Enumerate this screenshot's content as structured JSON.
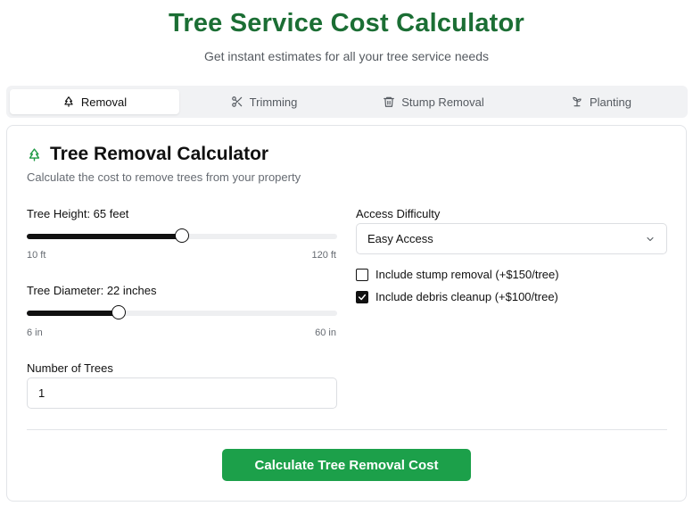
{
  "header": {
    "title": "Tree Service Cost Calculator",
    "subtitle": "Get instant estimates for all your tree service needs"
  },
  "tabs": [
    {
      "label": "Removal",
      "icon": "tree-icon",
      "active": true
    },
    {
      "label": "Trimming",
      "icon": "scissors-icon",
      "active": false
    },
    {
      "label": "Stump Removal",
      "icon": "trash-icon",
      "active": false
    },
    {
      "label": "Planting",
      "icon": "sprout-icon",
      "active": false
    }
  ],
  "card": {
    "title": "Tree Removal Calculator",
    "title_icon": "tree-icon",
    "description": "Calculate the cost to remove trees from your property"
  },
  "height_slider": {
    "label": "Tree Height: 65 feet",
    "value": 65,
    "min": 10,
    "max": 120,
    "min_label": "10 ft",
    "max_label": "120 ft"
  },
  "diameter_slider": {
    "label": "Tree Diameter: 22 inches",
    "value": 22,
    "min": 6,
    "max": 60,
    "min_label": "6 in",
    "max_label": "60 in"
  },
  "trees": {
    "label": "Number of Trees",
    "value": "1"
  },
  "access": {
    "label": "Access Difficulty",
    "selected": "Easy Access"
  },
  "options": [
    {
      "label": "Include stump removal (+$150/tree)",
      "checked": false
    },
    {
      "label": "Include debris cleanup (+$100/tree)",
      "checked": true
    }
  ],
  "calculate_button": "Calculate Tree Removal Cost",
  "colors": {
    "brand_green": "#1b6e34",
    "button_green": "#1ca04a",
    "icon_green": "#1f9a45"
  }
}
